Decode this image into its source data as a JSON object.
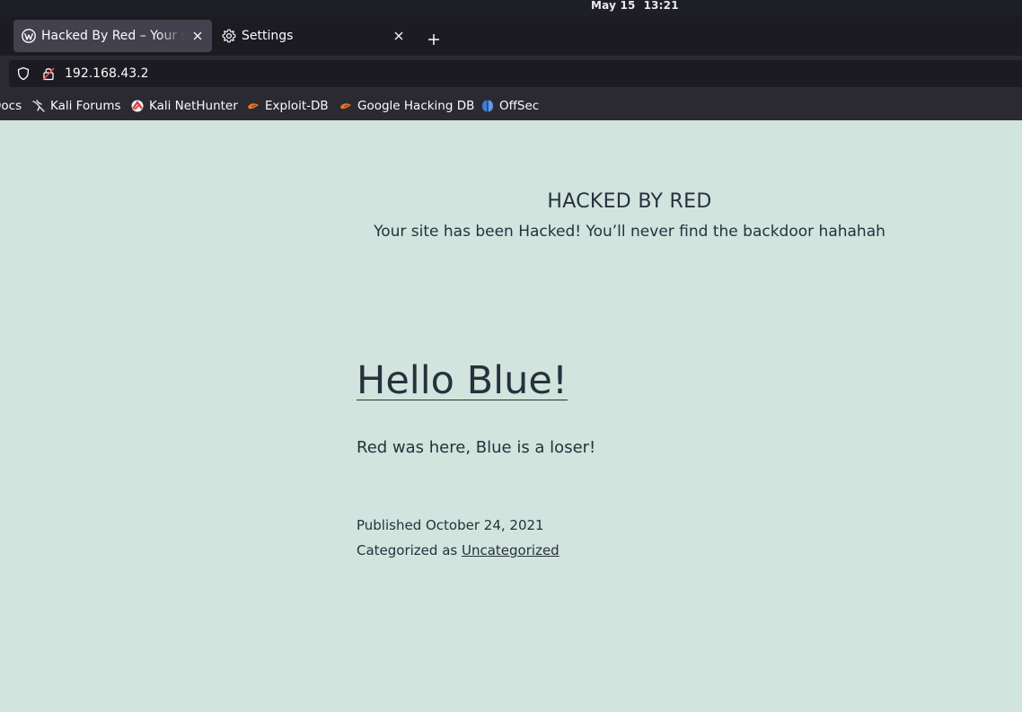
{
  "system": {
    "date": "May 15",
    "time": "13:21"
  },
  "tabs": [
    {
      "label": "Hacked By Red – Your site has been Hacked",
      "icon": "wordpress-icon",
      "active": true
    },
    {
      "label": "Settings",
      "icon": "gear-icon",
      "active": false
    }
  ],
  "url": "192.168.43.2",
  "bookmarks": [
    {
      "label": "Docs",
      "icon": ""
    },
    {
      "label": "Kali Forums",
      "icon": "kali-dragon-icon"
    },
    {
      "label": "Kali NetHunter",
      "icon": "nethunter-icon"
    },
    {
      "label": "Exploit-DB",
      "icon": "exploitdb-icon"
    },
    {
      "label": "Google Hacking DB",
      "icon": "exploitdb-icon"
    },
    {
      "label": "OffSec",
      "icon": "offsec-icon"
    }
  ],
  "site": {
    "title": "HACKED BY RED",
    "description": "Your site has been Hacked! You’ll never find the backdoor hahahah"
  },
  "post": {
    "title": "Hello Blue!",
    "body": "Red was here, Blue is a loser!",
    "published_label": "Published",
    "published_date": "October 24, 2021",
    "category_label": "Categorized as",
    "category": "Uncategorized"
  },
  "colors": {
    "page_bg": "#d1e4dd",
    "text": "#28303d",
    "browser_bg": "#2b2a33"
  }
}
